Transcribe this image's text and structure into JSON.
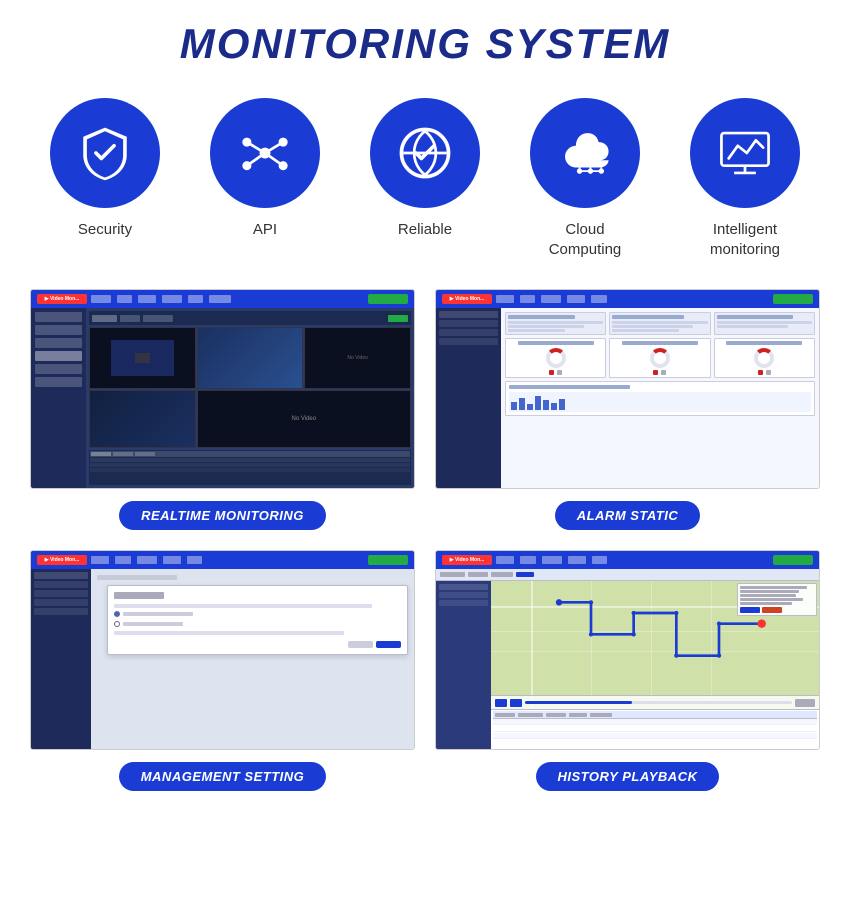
{
  "page": {
    "title": "MONITORING SYSTEM"
  },
  "features": [
    {
      "id": "security",
      "label": "Security",
      "icon": "shield"
    },
    {
      "id": "api",
      "label": "API",
      "icon": "network"
    },
    {
      "id": "reliable",
      "label": "Reliable",
      "icon": "verified"
    },
    {
      "id": "cloud",
      "label": "Cloud\nComputing",
      "icon": "cloud"
    },
    {
      "id": "monitoring",
      "label": "Intelligent\nmonitoring",
      "icon": "chart-monitor"
    }
  ],
  "screenshots": [
    {
      "id": "realtime",
      "label": "REALTIME MONITORING",
      "type": "realtime"
    },
    {
      "id": "alarm",
      "label": "ALARM STATIC",
      "type": "alarm"
    },
    {
      "id": "management",
      "label": "MANAGEMENT SETTING",
      "type": "management"
    },
    {
      "id": "history",
      "label": "HISTORY PLAYBACK",
      "type": "history"
    }
  ]
}
